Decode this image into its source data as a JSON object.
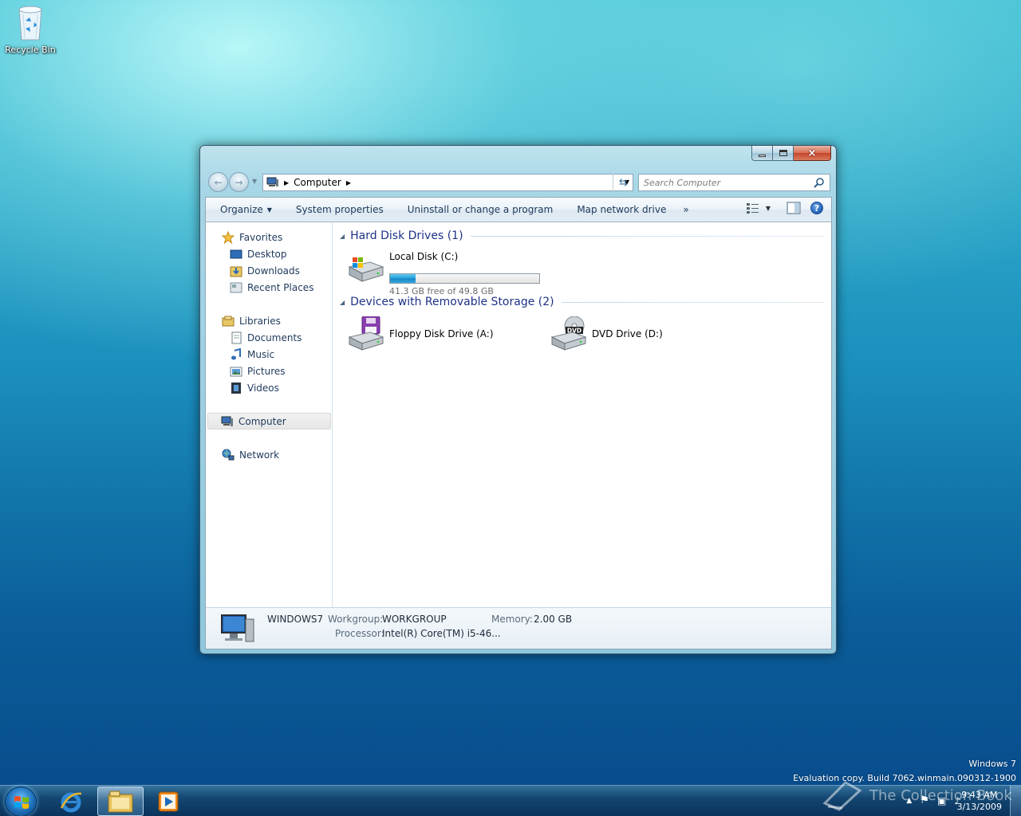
{
  "desktop": {
    "recycle_bin_label": "Recycle Bin",
    "watermark_line1": "Windows 7",
    "watermark_line2": "Evaluation copy. Build 7062.winmain.090312-1900",
    "overlay_logo_text": "The Collection Book"
  },
  "window": {
    "caption_buttons": {
      "minimize": "minimize-icon",
      "maximize": "maximize-icon",
      "close": "×"
    },
    "address": {
      "crumbs": [
        "Computer"
      ],
      "root_icon": "computer-icon"
    },
    "search": {
      "placeholder": "Search Computer",
      "value": ""
    },
    "toolbar": {
      "organize": "Organize",
      "system_properties": "System properties",
      "uninstall": "Uninstall or change a program",
      "map_drive": "Map network drive",
      "more": "»"
    },
    "nav": {
      "favorites": "Favorites",
      "desktop": "Desktop",
      "downloads": "Downloads",
      "recent": "Recent Places",
      "libraries": "Libraries",
      "documents": "Documents",
      "music": "Music",
      "pictures": "Pictures",
      "videos": "Videos",
      "computer": "Computer",
      "network": "Network"
    },
    "groups": {
      "hdd_title": "Hard Disk Drives (1)",
      "removable_title": "Devices with Removable Storage (2)"
    },
    "drives": {
      "c": {
        "name": "Local Disk (C:)",
        "free": "41.3 GB free of 49.8 GB",
        "used_fraction": 0.17
      },
      "a": {
        "name": "Floppy Disk Drive (A:)"
      },
      "d": {
        "name": "DVD Drive (D:)",
        "badge": "DVD"
      }
    },
    "details": {
      "name": "WINDOWS7",
      "workgroup_label": "Workgroup:",
      "workgroup_value": "WORKGROUP",
      "memory_label": "Memory:",
      "memory_value": "2.00 GB",
      "processor_label": "Processor:",
      "processor_value": "Intel(R) Core(TM) i5-46..."
    }
  },
  "taskbar": {
    "time": "9:43 AM",
    "date": "3/13/2009",
    "pinned": [
      "internet-explorer-icon",
      "windows-explorer-icon",
      "media-player-icon"
    ]
  },
  "colors": {
    "accent": "#1e3287",
    "progress": "#26a0da",
    "text": "#1e395b"
  }
}
